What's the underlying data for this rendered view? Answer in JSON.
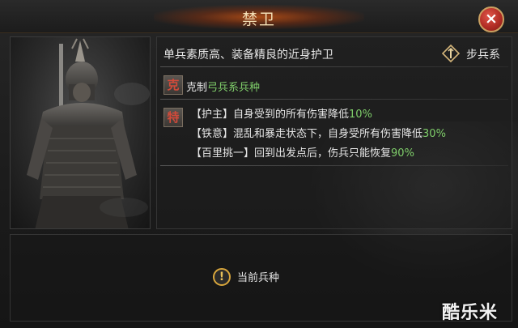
{
  "title": "禁卫",
  "close_label": "×",
  "unit": {
    "description": "单兵素质高、装备精良的近身护卫",
    "type_label": "步兵系",
    "counter": {
      "badge": "克",
      "prefix": "克制",
      "target": "弓兵系兵种"
    },
    "traits_badge": "特",
    "traits": [
      {
        "name": "【护主】",
        "text": "自身受到的所有伤害降低",
        "value": "10%"
      },
      {
        "name": "【铁意】",
        "text": "混乱和暴走状态下，自身受所有伤害降低",
        "value": "30%"
      },
      {
        "name": "【百里挑一】",
        "text": "回到出发点后，伤兵只能恢复",
        "value": "90%"
      }
    ]
  },
  "status": {
    "icon_glyph": "!",
    "current_label": "当前兵种"
  },
  "watermark": "酷乐米"
}
